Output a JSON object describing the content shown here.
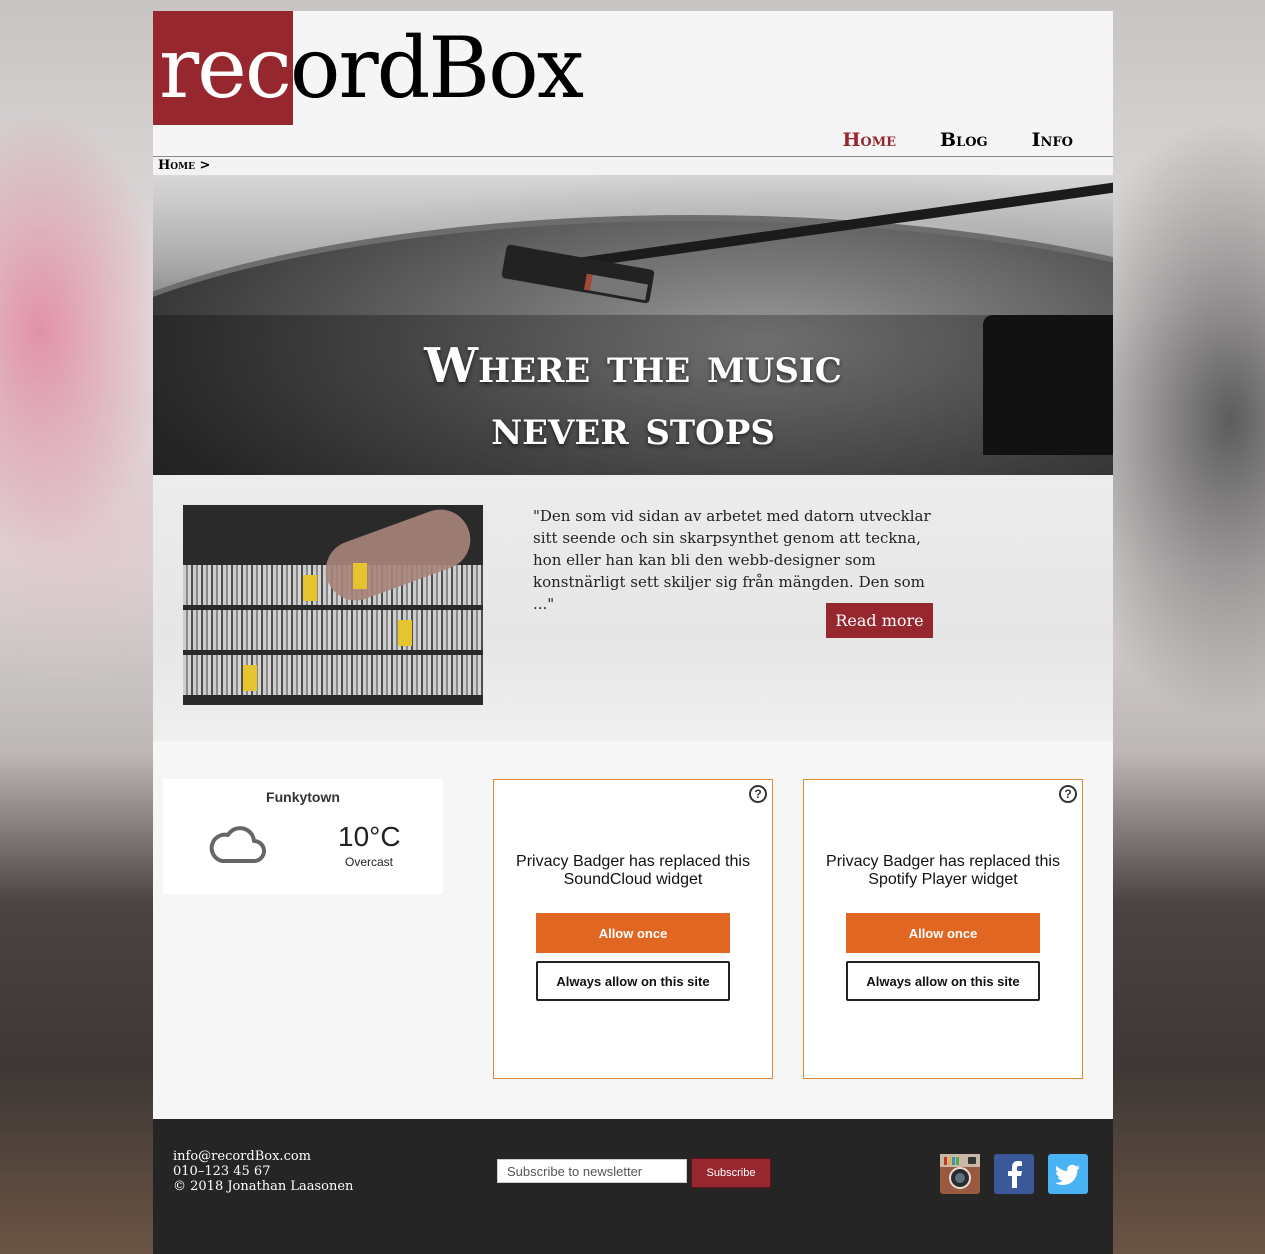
{
  "site": {
    "logo_part1": "rec",
    "logo_part2": "ordBox",
    "brand_color": "#97272e"
  },
  "nav": {
    "items": [
      {
        "label": "Home",
        "active": true
      },
      {
        "label": "Blog",
        "active": false
      },
      {
        "label": "Info",
        "active": false
      }
    ]
  },
  "breadcrumb": "Home >",
  "hero": {
    "title_line1": "Where the music",
    "title_line2": "never stops"
  },
  "article": {
    "quote": "\"Den som vid sidan av arbetet med datorn utvecklar sitt seende och sin skarpsynthet genom att teckna, hon eller han kan bli den webb-designer som konstnärligt sett skiljer sig från mängden. Den som ...\"",
    "read_more_label": "Read more"
  },
  "weather": {
    "city": "Funkytown",
    "temperature": "10°C",
    "condition": "Overcast",
    "icon": "cloud-icon"
  },
  "privacy_badger": {
    "widgets": [
      {
        "message": "Privacy Badger has replaced this SoundCloud widget",
        "allow_once": "Allow once",
        "always_allow": "Always allow on this site"
      },
      {
        "message": "Privacy Badger has replaced this Spotify Player widget",
        "allow_once": "Allow once",
        "always_allow": "Always allow on this site"
      }
    ],
    "help_glyph": "?",
    "accent_color": "#e06622"
  },
  "footer": {
    "email": "info@recordBox.com",
    "phone": "010–123 45 67",
    "copyright": "© 2018 Jonathan Laasonen",
    "newsletter_placeholder": "Subscribe to newsletter",
    "subscribe_label": "Subscribe",
    "social": [
      "instagram-icon",
      "facebook-icon",
      "twitter-icon"
    ]
  }
}
